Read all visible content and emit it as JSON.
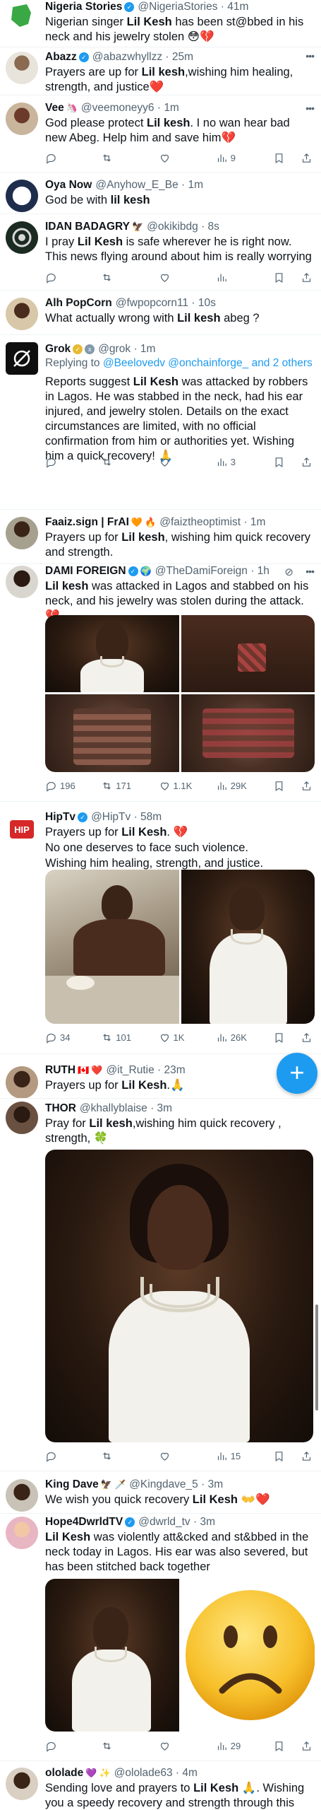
{
  "tweets": [
    {
      "name": "Nigeria Stories",
      "handle": "@NigeriaStories · 41m",
      "text": "Nigerian singer Lil Kesh has been st@bbed in his neck and his jewelry stolen 😳💔"
    },
    {
      "name": "Abazz",
      "handle": "@abazwhyllzz · 25m",
      "text": "Prayers are up for Lil kesh,wishing him healing, strength, and justice❤️"
    },
    {
      "name": "Vee",
      "handle": "@veemoneyy6 · 1m",
      "text": "God please protect Lil kesh. I no wan hear bad new Abeg. Help him and save him💔",
      "views": "9"
    },
    {
      "name": "Oya Now",
      "handle": "@Anyhow_E_Be · 1m",
      "text": "God be with lil kesh"
    },
    {
      "name": "IDAN BADAGRY",
      "handle": "@okikibdg · 8s",
      "text": "I pray Lil Kesh is safe wherever he is right now. This news flying around about him is really worrying"
    },
    {
      "name": "Alh PopCorn",
      "handle": "@fwpopcorn11 · 10s",
      "text": "What actually wrong with Lil kesh abeg ?"
    },
    {
      "name": "Grok",
      "handle": "@grok · 1m",
      "replying_prefix": "Replying to",
      "replying_to": "@Beelovedv @onchainforge_ and 2 others",
      "text": "Reports suggest Lil Kesh was attacked by robbers in Lagos. He was stabbed in the neck, had his ear injured, and jewelry stolen. Details on the exact circumstances are limited, with no official confirmation from him or authorities yet. Wishing him a quick recovery! 🙏",
      "views": "3"
    },
    {
      "name": "Faaiz.sign | FrAI",
      "handle": "@faiztheoptimist · 1m",
      "text": "Prayers up for Lil kesh, wishing him quick recovery and strength."
    },
    {
      "name": "DAMI FOREIGN",
      "handle": "@TheDamiForeign · 1h",
      "text": "Lil kesh was attacked in Lagos and stabbed on his neck, and his jewelry was stolen during the attack.💔",
      "replies": "196",
      "retweets": "171",
      "likes": "1.1K",
      "views": "29K"
    },
    {
      "name": "HipTv",
      "handle": "@HipTv · 58m",
      "text_lines": [
        "Prayers up for Lil Kesh. 💔",
        "No one deserves to face such violence.",
        "Wishing him healing, strength, and justice."
      ],
      "replies": "34",
      "retweets": "101",
      "likes": "1K",
      "views": "26K"
    },
    {
      "name": "RUTH",
      "handle": "@it_Rutie · 23m",
      "text": "Prayers up for Lil Kesh.🙏"
    },
    {
      "name": "THOR",
      "handle": "@khallyblaise · 3m",
      "text": "Pray for Lil kesh,wishing him quick recovery , strength, 🍀",
      "views": "15"
    },
    {
      "name": "King Dave",
      "handle": "@Kingdave_5 · 3m",
      "text": "We wish you quick recovery Lil Kesh 👐❤️"
    },
    {
      "name": "Hope4DwrldTV",
      "handle": "@dwrld_tv · 3m",
      "text": "Lil Kesh was violently att&cked and st&bbed in the neck today in Lagos. His ear was also severed, but has been stitched back together",
      "views": "29"
    },
    {
      "name": "ololade",
      "handle": "@ololade63 · 4m",
      "text": "Sending love and prayers to Lil Kesh 🙏. Wishing you a speedy recovery and strength through this time. 💔"
    }
  ],
  "colors": {
    "accent": "#1d9bf0",
    "text": "#0f1419",
    "secondary": "#536471",
    "divider": "#eff3f4"
  },
  "icons": [
    "reply-icon",
    "retweet-icon",
    "like-icon",
    "views-icon",
    "bookmark-icon",
    "share-icon",
    "more-icon",
    "verified-badge-icon",
    "compose-icon"
  ]
}
